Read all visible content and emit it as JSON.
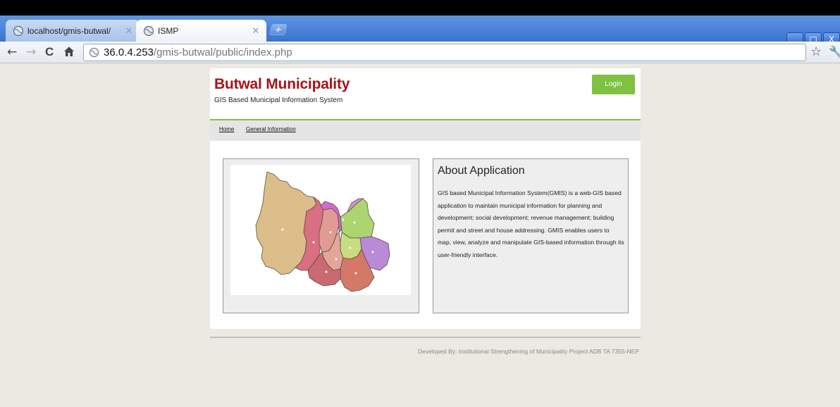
{
  "browser": {
    "tabs": [
      {
        "title": "localhost/gmis-butwal/",
        "active": false
      },
      {
        "title": "ISMP",
        "active": true
      }
    ],
    "new_tab_symbol": "+",
    "url_host": "36.0.4.253",
    "url_path": "/gmis-butwal/public/index.php",
    "nav": {
      "back": "←",
      "forward": "→",
      "reload": "C",
      "home": "🏠"
    },
    "window_controls": [
      "_",
      "□",
      "X"
    ],
    "icons": {
      "page": "globe-icon",
      "bookmark": "star-icon",
      "menu": "wrench-icon"
    }
  },
  "page": {
    "site_title": "Butwal Municipality",
    "site_subtitle": "GIS Based Municipal Information System",
    "login_label": "Login",
    "nav_links": [
      "Home",
      "General Information"
    ],
    "about": {
      "title": "About Application",
      "text": "GIS based Municipal Information System(GMIS) is a web-GIS based application to maintain municipal information for planning and development; social development; revenue management; building permit and street and house addressing. GMIS enables users to map, view, analyze and manipulate GIS-based information through its user-friendly interface."
    },
    "footer": "Developed By: Institutional Strengthening of Municipality Project ADB TA 7355-NEP"
  },
  "colors": {
    "brand_red": "#a3141a",
    "accent_green": "#7fc241",
    "page_background": "#ece9e2"
  },
  "map": {
    "image": "municipal-ward-map",
    "ward_colors": [
      "#dcbe8a",
      "#d86f82",
      "#df9b94",
      "#d06ad4",
      "#acd471",
      "#cf93cc",
      "#d47868",
      "#c8dc82",
      "#e4a59b",
      "#b88ad8"
    ]
  }
}
